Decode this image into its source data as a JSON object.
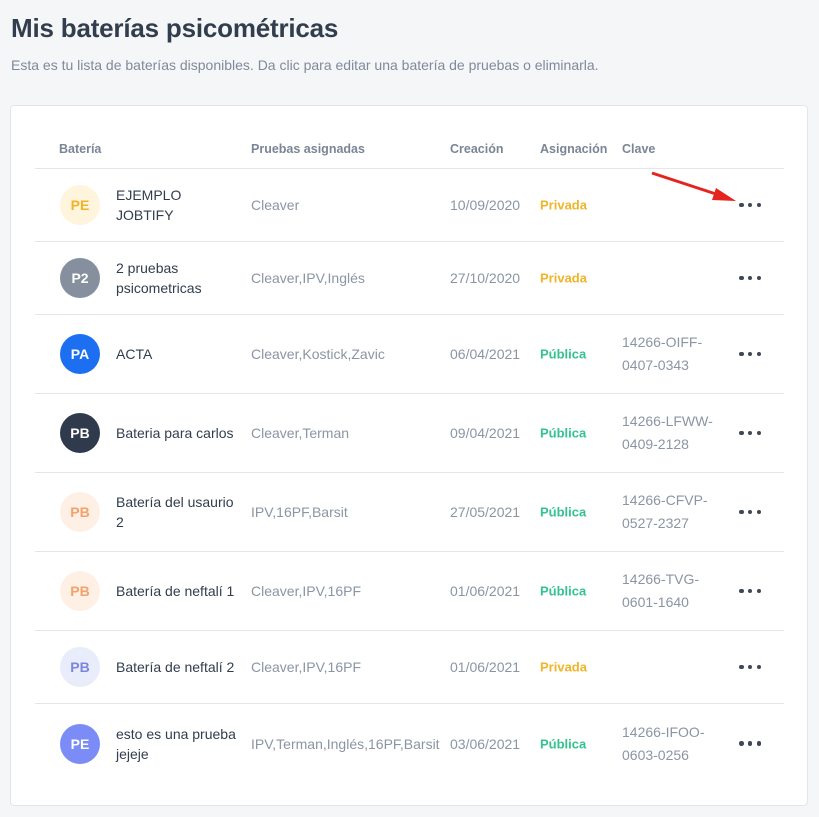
{
  "header": {
    "title": "Mis baterías psicométricas",
    "subtitle": "Esta es tu lista de baterías disponibles. Da clic para editar una batería de pruebas o eliminarla."
  },
  "table": {
    "columns": {
      "bateria": "Batería",
      "pruebas": "Pruebas asignadas",
      "creacion": "Creación",
      "asignacion": "Asignación",
      "clave": "Clave"
    },
    "rows": [
      {
        "initials": "PE",
        "name": "EJEMPLO JOBTIFY",
        "tests": "Cleaver",
        "date": "10/09/2020",
        "assignment": "Privada",
        "key": "",
        "avatar_bg": "#fff4dc",
        "avatar_fg": "#f0b429",
        "height": 73
      },
      {
        "initials": "P2",
        "name": "2 pruebas psicometricas",
        "tests": "Cleaver,IPV,Inglés",
        "date": "27/10/2020",
        "assignment": "Privada",
        "key": "",
        "avatar_bg": "#858f9d",
        "avatar_fg": "#ffffff",
        "height": 73
      },
      {
        "initials": "PA",
        "name": "ACTA",
        "tests": "Cleaver,Kostick,Zavic",
        "date": "06/04/2021",
        "assignment": "Pública",
        "key": "14266-OIFF-0407-0343",
        "avatar_bg": "#1d6ff2",
        "avatar_fg": "#ffffff",
        "height": 79
      },
      {
        "initials": "PB",
        "name": "Bateria para carlos",
        "tests": "Cleaver,Terman",
        "date": "09/04/2021",
        "assignment": "Pública",
        "key": "14266-LFWW-0409-2128",
        "avatar_bg": "#2f3b4d",
        "avatar_fg": "#ffffff",
        "height": 79
      },
      {
        "initials": "PB",
        "name": "Batería del usaurio 2",
        "tests": "IPV,16PF,Barsit",
        "date": "27/05/2021",
        "assignment": "Pública",
        "key": "14266-CFVP-0527-2327",
        "avatar_bg": "#fff0e6",
        "avatar_fg": "#f3a26b",
        "height": 79
      },
      {
        "initials": "PB",
        "name": "Batería de neftalí 1",
        "tests": "Cleaver,IPV,16PF",
        "date": "01/06/2021",
        "assignment": "Pública",
        "key": "14266-TVG-0601-1640",
        "avatar_bg": "#fff0e6",
        "avatar_fg": "#f3a26b",
        "height": 79
      },
      {
        "initials": "PB",
        "name": "Batería de neftalí 2",
        "tests": "Cleaver,IPV,16PF",
        "date": "01/06/2021",
        "assignment": "Privada",
        "key": "",
        "avatar_bg": "#e9ecfb",
        "avatar_fg": "#7a87df",
        "height": 73
      },
      {
        "initials": "PE",
        "name": "esto es una prueba jejeje",
        "tests": "IPV,Terman,Inglés,16PF,Barsit",
        "date": "03/06/2021",
        "assignment": "Pública",
        "key": "14266-IFOO-0603-0256",
        "avatar_bg": "#7b8cf6",
        "avatar_fg": "#ffffff",
        "height": 79
      }
    ]
  },
  "annotation": {
    "arrow_color": "#e5231f"
  }
}
